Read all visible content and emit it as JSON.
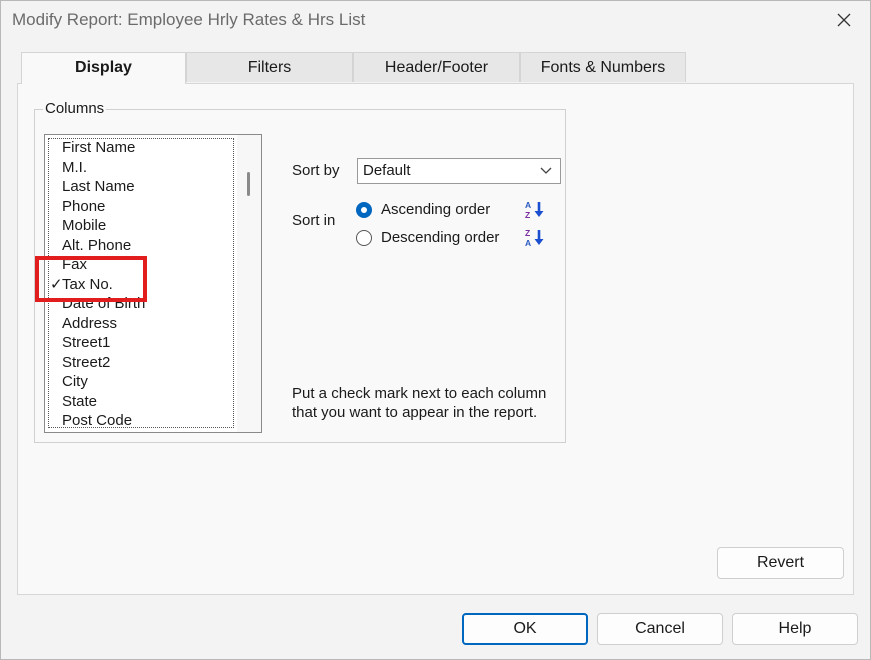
{
  "window": {
    "title": "Modify Report: Employee Hrly Rates & Hrs List"
  },
  "tabs": [
    {
      "label": "Display",
      "active": true
    },
    {
      "label": "Filters",
      "active": false
    },
    {
      "label": "Header/Footer",
      "active": false
    },
    {
      "label": "Fonts & Numbers",
      "active": false
    }
  ],
  "columns": {
    "group_label": "Columns",
    "items": [
      {
        "label": "First Name",
        "checked": false
      },
      {
        "label": "M.I.",
        "checked": false
      },
      {
        "label": "Last Name",
        "checked": false
      },
      {
        "label": "Phone",
        "checked": false
      },
      {
        "label": "Mobile",
        "checked": false
      },
      {
        "label": "Alt. Phone",
        "checked": false
      },
      {
        "label": "Fax",
        "checked": false
      },
      {
        "label": "Tax No.",
        "checked": true
      },
      {
        "label": "Date of Birth",
        "checked": false
      },
      {
        "label": "Address",
        "checked": false
      },
      {
        "label": "Street1",
        "checked": false
      },
      {
        "label": "Street2",
        "checked": false
      },
      {
        "label": "City",
        "checked": false
      },
      {
        "label": "State",
        "checked": false
      },
      {
        "label": "Post Code",
        "checked": false
      }
    ],
    "check_glyph": "✓"
  },
  "sort": {
    "sort_by_label": "Sort by",
    "sort_by_value": "Default",
    "sort_in_label": "Sort in",
    "ascending_label": "Ascending order",
    "descending_label": "Descending order",
    "ascending_checked": true,
    "descending_checked": false
  },
  "help_text": "Put a check mark next to each column that you want to appear in the report.",
  "buttons": {
    "revert": "Revert",
    "ok": "OK",
    "cancel": "Cancel",
    "help": "Help"
  },
  "colors": {
    "accent": "#0067c0",
    "highlight": "#e11d1d"
  },
  "icons": {
    "sort_ascending": "sort-az-icon",
    "sort_descending": "sort-za-icon",
    "close": "close-icon",
    "dropdown": "chevron-down-icon"
  }
}
